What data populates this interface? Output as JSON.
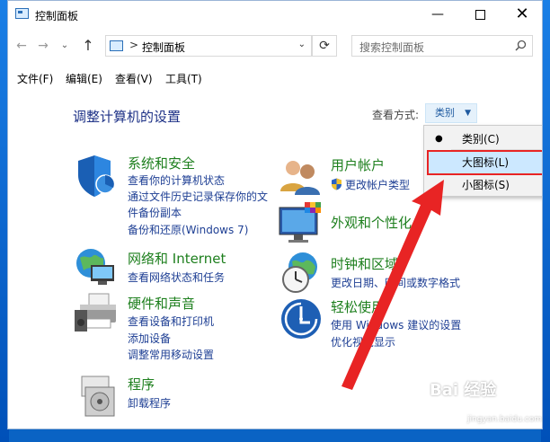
{
  "window": {
    "title": "控制面板",
    "controls": {
      "minimize": "—",
      "close": "✕"
    }
  },
  "nav": {
    "back": "←",
    "forward": "→",
    "recent": "⌄",
    "up": "↑",
    "address_sep": ">",
    "address": "控制面板",
    "refresh": "⟳",
    "search_placeholder": "搜索控制面板"
  },
  "menu": [
    "文件(F)",
    "编辑(E)",
    "查看(V)",
    "工具(T)"
  ],
  "heading": "调整计算机的设置",
  "view_by": {
    "label": "查看方式:",
    "value": "类别"
  },
  "dropdown": {
    "items": [
      {
        "label": "类别(C)",
        "selected": true
      },
      {
        "label": "大图标(L)",
        "highlighted": true
      },
      {
        "label": "小图标(S)"
      }
    ]
  },
  "categories": {
    "system_security": {
      "title": "系统和安全",
      "links": [
        "查看你的计算机状态",
        "通过文件历史记录保存你的文",
        "件备份副本",
        "备份和还原(Windows 7)"
      ]
    },
    "network": {
      "title": "网络和 Internet",
      "links": [
        "查看网络状态和任务"
      ]
    },
    "hardware": {
      "title": "硬件和声音",
      "links": [
        "查看设备和打印机",
        "添加设备",
        "调整常用移动设置"
      ]
    },
    "programs": {
      "title": "程序",
      "links": [
        "卸载程序"
      ]
    },
    "user_accounts": {
      "title": "用户帐户",
      "links": [
        "更改帐户类型"
      ]
    },
    "appearance": {
      "title": "外观和个性化",
      "links": []
    },
    "clock_region": {
      "title": "时钟和区域",
      "links": [
        "更改日期、时间或数字格式"
      ]
    },
    "ease_access": {
      "title": "轻松使用",
      "links": [
        "使用 Windows 建议的设置",
        "优化视觉显示"
      ]
    }
  },
  "watermark": {
    "text": "Bai 经验",
    "url": "jingyan.baidu.com"
  },
  "colors": {
    "accent": "#1e3f94",
    "category_title": "#1d7f1d",
    "heading": "#1e3287",
    "annotation": "#e82424"
  }
}
